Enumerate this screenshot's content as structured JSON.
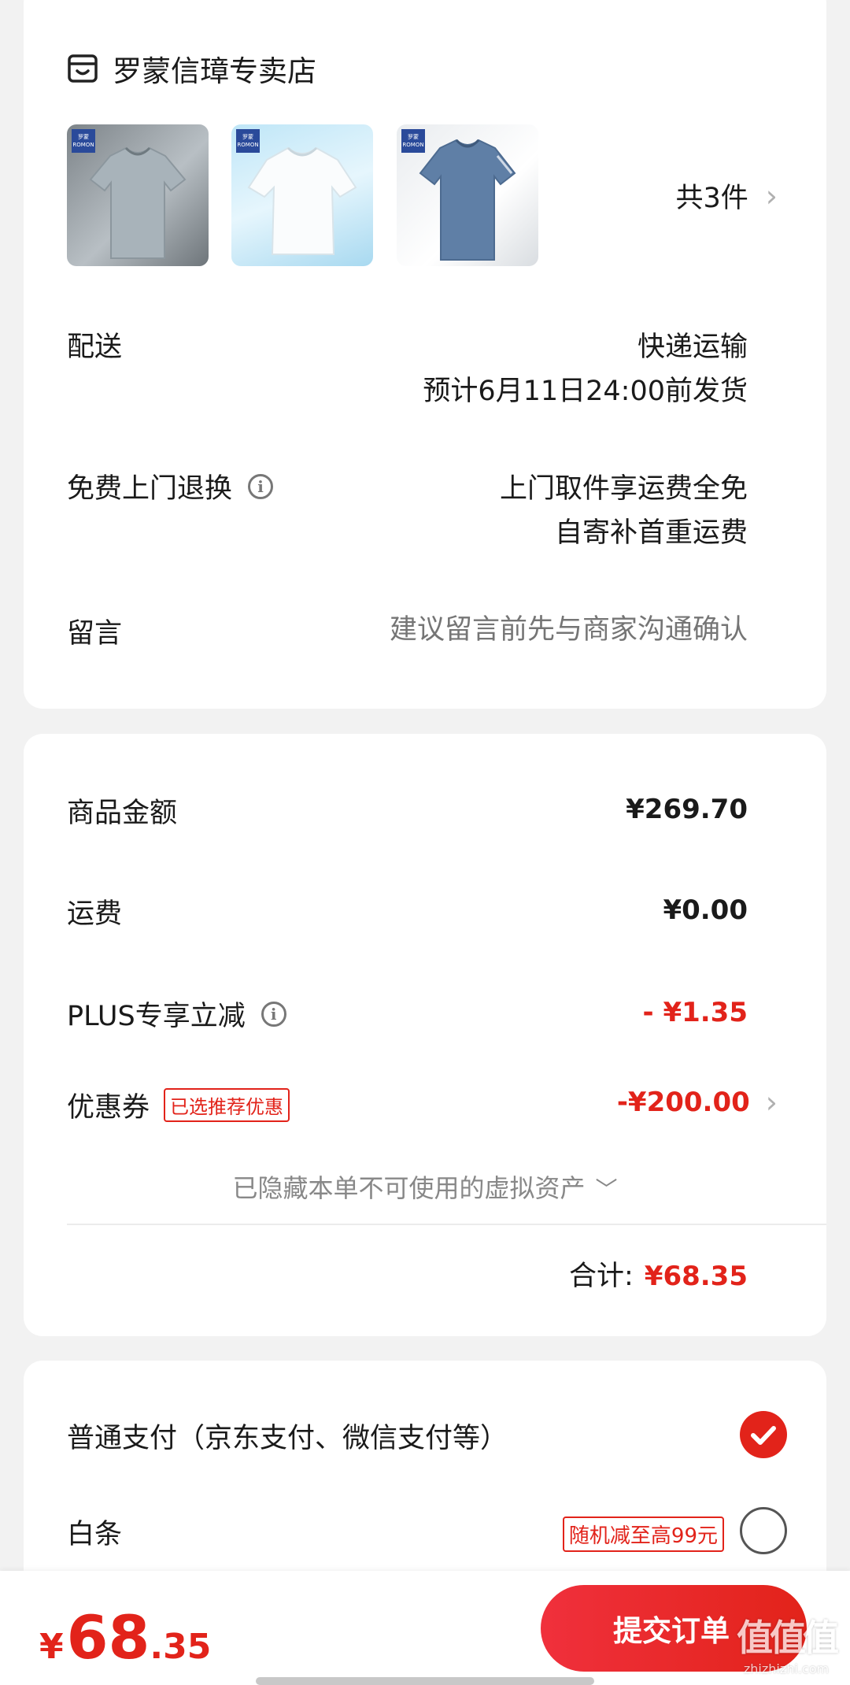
{
  "shop": {
    "name": "罗蒙信璋专卖店",
    "icon": "store-icon"
  },
  "products": {
    "count_label": "共3件",
    "items": [
      {
        "brand_cn": "罗蒙",
        "brand_en": "ROMON",
        "color": "#9aa5ab"
      },
      {
        "brand_cn": "罗蒙",
        "brand_en": "ROMON",
        "color": "#f4f6f8"
      },
      {
        "brand_cn": "罗蒙",
        "brand_en": "ROMON",
        "color": "#5f7fa6"
      }
    ]
  },
  "delivery": {
    "label": "配送",
    "method": "快递运输",
    "estimate": "预计6月11日24:00前发货"
  },
  "returns": {
    "label": "免费上门退换",
    "line1": "上门取件享运费全免",
    "line2": "自寄补首重运费"
  },
  "message": {
    "label": "留言",
    "placeholder": "建议留言前先与商家沟通确认"
  },
  "summary": {
    "goods_label": "商品金额",
    "goods_value": "¥269.70",
    "shipping_label": "运费",
    "shipping_value": "¥0.00",
    "plus_label": "PLUS专享立减",
    "plus_value": "- ¥1.35",
    "coupon_label": "优惠券",
    "coupon_tag": "已选推荐优惠",
    "coupon_value": "-¥200.00",
    "hidden_assets": "已隐藏本单不可使用的虚拟资产",
    "total_label": "合计:",
    "total_value": "¥68.35"
  },
  "payment": {
    "normal_label": "普通支付（京东支付、微信支付等）",
    "baitiao_label": "白条",
    "baitiao_tag": "随机减至高99元"
  },
  "footer": {
    "currency": "¥",
    "price_int": "68",
    "price_dec": ".35",
    "submit_label": "提交订单"
  },
  "watermark": {
    "text": "值值值",
    "domain": "zhizhizhi.com"
  },
  "colors": {
    "accent": "#e2231a",
    "background": "#f2f2f2"
  }
}
